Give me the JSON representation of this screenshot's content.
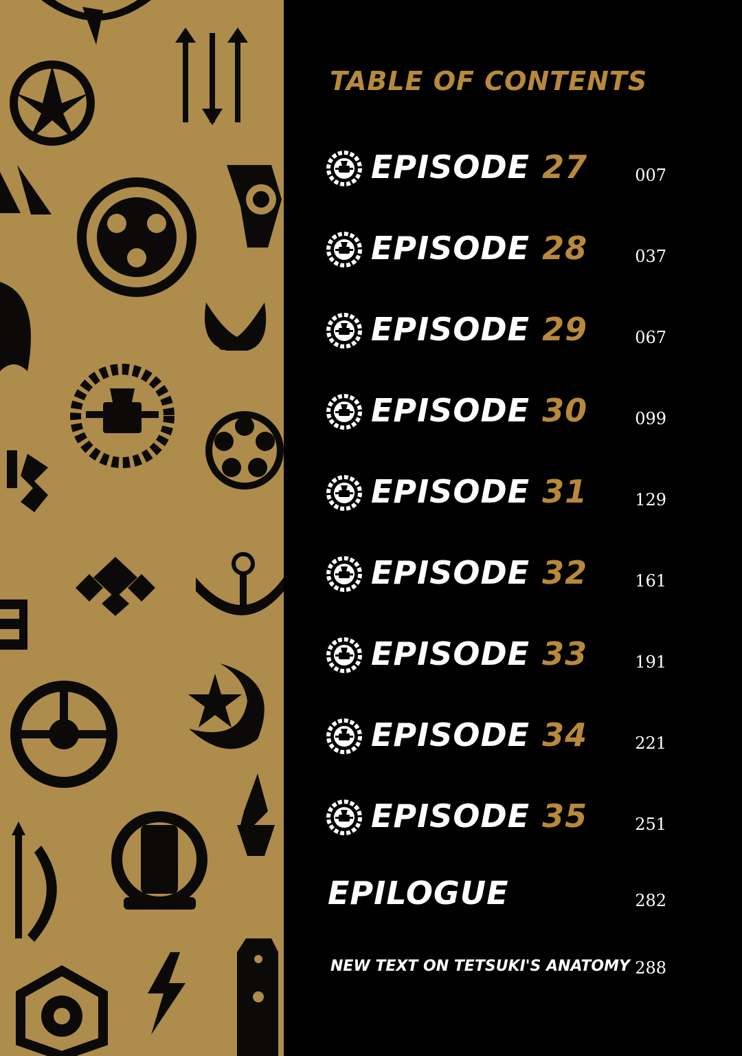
{
  "toc": {
    "title": "TABLE OF CONTENTS",
    "episode_word": "EPISODE",
    "episodes": [
      {
        "number": "27",
        "page": "007"
      },
      {
        "number": "28",
        "page": "037"
      },
      {
        "number": "29",
        "page": "067"
      },
      {
        "number": "30",
        "page": "099"
      },
      {
        "number": "31",
        "page": "129"
      },
      {
        "number": "32",
        "page": "161"
      },
      {
        "number": "33",
        "page": "191"
      },
      {
        "number": "34",
        "page": "221"
      },
      {
        "number": "35",
        "page": "251"
      }
    ],
    "epilogue": {
      "label": "EPILOGUE",
      "page": "282"
    },
    "extra": {
      "label": "NEW TEXT ON TETSUKI'S ANATOMY",
      "page": "288"
    }
  },
  "colors": {
    "panel": "#ad8c4c",
    "accent": "#b8893b",
    "ink": "#000000",
    "text": "#ffffff"
  },
  "icons": {
    "episode_marker": "clan-crest-icon",
    "pattern": [
      "leaf-crest-icon",
      "arrows-crest-icon",
      "gear-crest-icon",
      "horned-mask-crest-icon",
      "sawblade-crest-icon",
      "flower-crest-icon",
      "diamond-crest-icon",
      "anchor-crest-icon",
      "pentagram-moon-crest-icon",
      "wheel-crest-icon",
      "spear-wreath-crest-icon",
      "rope-crest-icon",
      "lightning-crest-icon",
      "hexagon-crest-icon"
    ]
  }
}
